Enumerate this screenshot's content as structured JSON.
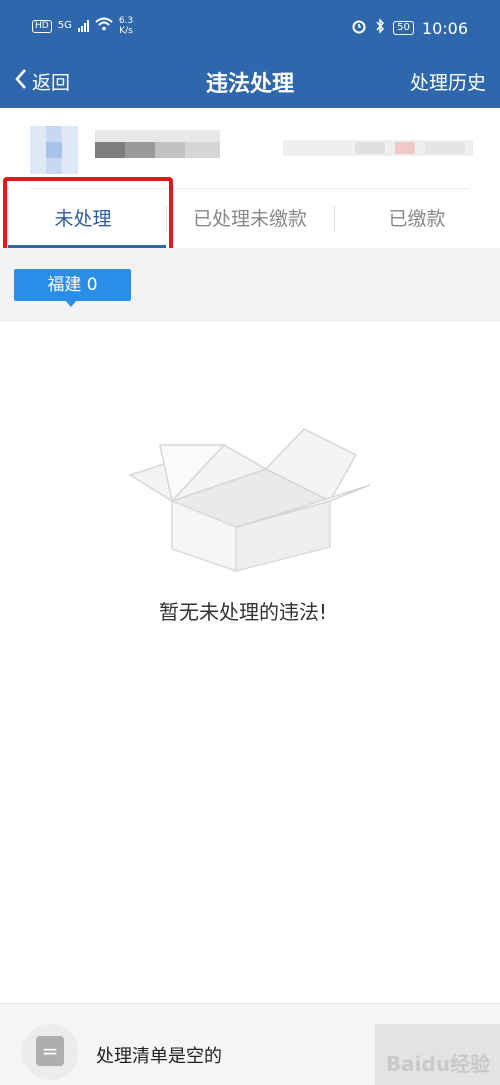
{
  "status_bar": {
    "hd": "HD",
    "network": "5G",
    "speed_value": "6.3",
    "speed_unit": "K/s",
    "battery": "50",
    "time": "10:06"
  },
  "nav": {
    "back_label": "返回",
    "title": "违法处理",
    "history_label": "处理历史"
  },
  "tabs": [
    {
      "label": "未处理",
      "active": true
    },
    {
      "label": "已处理未缴款",
      "active": false
    },
    {
      "label": "已缴款",
      "active": false
    }
  ],
  "filter": {
    "region_label": "福建 0"
  },
  "empty_state": {
    "message": "暂无未处理的违法!"
  },
  "bottom_bar": {
    "cart_icon": "list-icon",
    "status_text": "处理清单是空的"
  },
  "watermark": "Baidu经验",
  "colors": {
    "header": "#2f67ad",
    "accent": "#2a8ee8",
    "highlight": "#e3161a"
  }
}
